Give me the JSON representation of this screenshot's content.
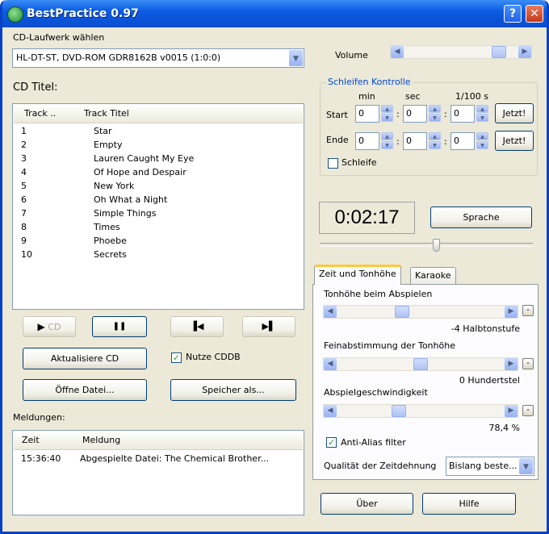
{
  "window": {
    "title": "BestPractice 0.97",
    "help_glyph": "?",
    "close_glyph": "✕"
  },
  "cd_drive": {
    "label": "CD-Laufwerk wählen",
    "selected": "HL-DT-ST, DVD-ROM GDR8162B v0015 (1:0:0)"
  },
  "cd_titles": {
    "label": "CD Titel:",
    "columns": [
      "Track ..",
      "Track Titel"
    ],
    "rows": [
      {
        "track": "1",
        "title": "Star"
      },
      {
        "track": "2",
        "title": "Empty"
      },
      {
        "track": "3",
        "title": "Lauren Caught My Eye"
      },
      {
        "track": "4",
        "title": "Of Hope and Despair"
      },
      {
        "track": "5",
        "title": "New York"
      },
      {
        "track": "6",
        "title": "Oh What a Night"
      },
      {
        "track": "7",
        "title": "Simple Things"
      },
      {
        "track": "8",
        "title": "Times"
      },
      {
        "track": "9",
        "title": "Phoebe"
      },
      {
        "track": "10",
        "title": "Secrets"
      }
    ]
  },
  "transport": {
    "play_cd": {
      "icon": "play-icon",
      "glyph": "▶",
      "label": "CD"
    },
    "pause": {
      "icon": "pause-icon",
      "glyph": "❚❚"
    },
    "prev": {
      "icon": "skip-previous-icon",
      "glyph": "▐◀"
    },
    "next": {
      "icon": "skip-next-icon",
      "glyph": "▶▌"
    }
  },
  "buttons": {
    "refresh_cd": "Aktualisiere CD",
    "use_cddb": "Nutze CDDB",
    "open_file": "Öffne Datei...",
    "save_as": "Speicher als...",
    "speech": "Sprache",
    "about": "Über",
    "help": "Hilfe"
  },
  "use_cddb_checked": true,
  "messages": {
    "label": "Meldungen:",
    "columns": [
      "Zeit",
      "Meldung"
    ],
    "rows": [
      {
        "time": "15:36:40",
        "message": "Abgespielte Datei: The Chemical Brother..."
      }
    ]
  },
  "volume": {
    "label": "Volume",
    "level": 0.88
  },
  "loop_control": {
    "title": "Schleifen Kontrolle",
    "col_min": "min",
    "col_sec": "sec",
    "col_hundredth": "1/100 s",
    "start": {
      "label": "Start",
      "min": "0",
      "sec": "0",
      "hundredth": "0",
      "now": "Jetzt!"
    },
    "end": {
      "label": "Ende",
      "min": "0",
      "sec": "0",
      "hundredth": "0",
      "now": "Jetzt!"
    },
    "loop_label": "Schleife",
    "loop_checked": false,
    "separator": ":"
  },
  "time_display": "0:02:17",
  "position": {
    "level": 0.55
  },
  "tabs": [
    {
      "label": "Zeit und Tonhöhe",
      "active": true
    },
    {
      "label": "Karaoke",
      "active": false
    }
  ],
  "pitch": {
    "label": "Tonhöhe beim Abspielen",
    "value_text": "-4 Halbtonstufe",
    "level": 0.38,
    "reset": "-"
  },
  "fine_tune": {
    "label": "Feinabstimmung der Tonhöhe",
    "value_text": "0 Hundertstel",
    "level": 0.5,
    "reset": "-"
  },
  "speed": {
    "label": "Abspielgeschwindigkeit",
    "value_text": "78,4 %",
    "level": 0.36,
    "reset": "-"
  },
  "anti_alias": {
    "label": "Anti-Alias filter",
    "checked": true
  },
  "quality": {
    "label": "Qualität der Zeitdehnung",
    "selected": "Bislang beste..."
  },
  "arrows": {
    "left": "◀",
    "right": "▶",
    "down": "▼",
    "up": "▲",
    "check": "✓"
  }
}
